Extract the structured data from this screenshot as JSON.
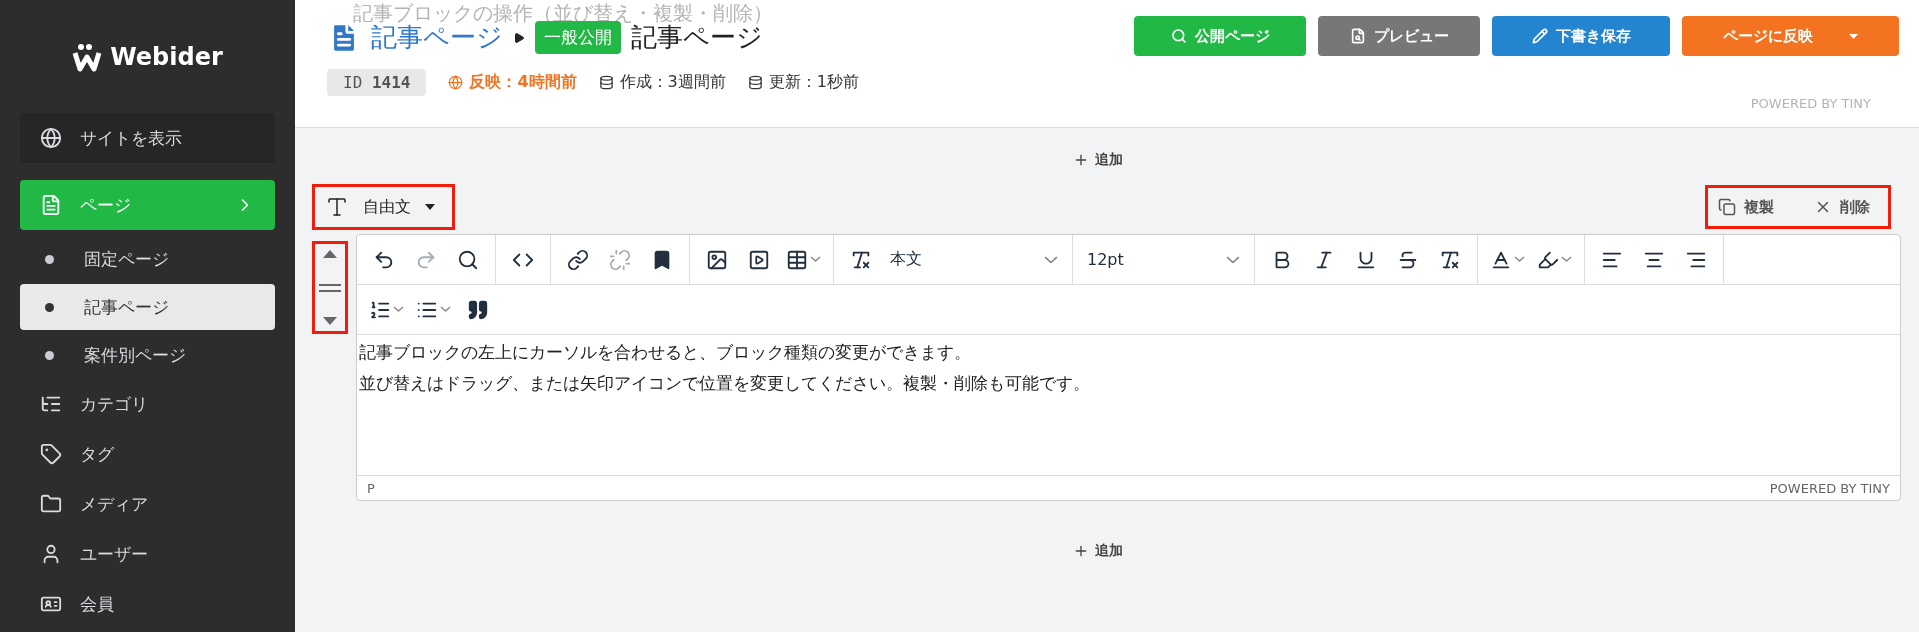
{
  "sidebar": {
    "logo": "Webider",
    "items": [
      {
        "label": "サイトを表示",
        "kind": "site",
        "selected": false
      },
      {
        "label": "ページ",
        "kind": "nav",
        "selected": true,
        "expanded": true,
        "children": [
          {
            "label": "固定ページ",
            "selected": false
          },
          {
            "label": "記事ページ",
            "selected": true
          },
          {
            "label": "案件別ページ",
            "selected": false
          }
        ]
      },
      {
        "label": "カテゴリ",
        "kind": "nav",
        "selected": false
      },
      {
        "label": "タグ",
        "kind": "nav",
        "selected": false
      },
      {
        "label": "メディア",
        "kind": "nav",
        "selected": false
      },
      {
        "label": "ユーザー",
        "kind": "nav",
        "selected": false
      },
      {
        "label": "会員",
        "kind": "nav",
        "selected": false
      }
    ]
  },
  "header": {
    "ghost_title": "記事ブロックの操作（並び替え・複製・削除）",
    "ghost_footer": "POWERED BY TINY",
    "breadcrumb": "記事ページ",
    "status_badge": "一般公開",
    "title": "記事ページ",
    "meta": [
      {
        "kind": "id",
        "label": "ID",
        "value": "1414"
      },
      {
        "kind": "published",
        "text": "反映：4時間前"
      },
      {
        "kind": "created",
        "text": "作成：3週間前"
      },
      {
        "kind": "updated",
        "text": "更新：1秒前"
      }
    ],
    "buttons": [
      {
        "kind": "public",
        "label": "公開ページ"
      },
      {
        "kind": "preview",
        "label": "プレビュー"
      },
      {
        "kind": "draft",
        "label": "下書き保存"
      },
      {
        "kind": "publish",
        "label": "ページに反映"
      }
    ]
  },
  "add_label_top": "追加",
  "block": {
    "type_label": "自由文",
    "highlighted": true,
    "actions": [
      {
        "kind": "copy",
        "label": "複製"
      },
      {
        "kind": "delete",
        "label": "削除"
      }
    ],
    "toolbar_rows": [
      [
        [
          {
            "kind": "undo",
            "disabled": false
          },
          {
            "kind": "redo",
            "disabled": true
          },
          {
            "kind": "search",
            "disabled": false
          }
        ],
        [
          {
            "kind": "code",
            "disabled": false
          }
        ],
        [
          {
            "kind": "link",
            "disabled": false
          },
          {
            "kind": "unlink",
            "disabled": true
          },
          {
            "kind": "bookmark",
            "disabled": false
          }
        ],
        [
          {
            "kind": "image",
            "disabled": false
          },
          {
            "kind": "media",
            "disabled": false
          },
          {
            "kind": "table",
            "disabled": false
          }
        ],
        [
          {
            "kind": "clear",
            "disabled": false
          },
          {
            "kind": "select",
            "value": "本文"
          }
        ],
        [
          {
            "kind": "select",
            "value": "12pt"
          }
        ],
        [
          {
            "kind": "bold",
            "disabled": false
          },
          {
            "kind": "italic",
            "disabled": false
          },
          {
            "kind": "underline",
            "disabled": false
          },
          {
            "kind": "strike",
            "disabled": false
          },
          {
            "kind": "clear",
            "disabled": false
          }
        ],
        [
          {
            "kind": "color",
            "disabled": false
          },
          {
            "kind": "highlight",
            "disabled": false
          }
        ],
        [
          {
            "kind": "align-left",
            "disabled": false
          },
          {
            "kind": "align-center",
            "disabled": false
          },
          {
            "kind": "align-right",
            "disabled": false
          }
        ]
      ],
      [
        [
          {
            "kind": "ordered",
            "disabled": false
          },
          {
            "kind": "bullet",
            "disabled": false
          },
          {
            "kind": "quote",
            "disabled": false
          }
        ]
      ]
    ],
    "paragraphs": [
      "記事ブロックの左上にカーソルを合わせると、ブロック種類の変更ができます。",
      "並び替えはドラッグ、または矢印アイコンで位置を変更してください。複製・削除も可能です。"
    ],
    "path": "P",
    "powered": "POWERED BY TINY"
  },
  "add_label_bottom": "追加"
}
